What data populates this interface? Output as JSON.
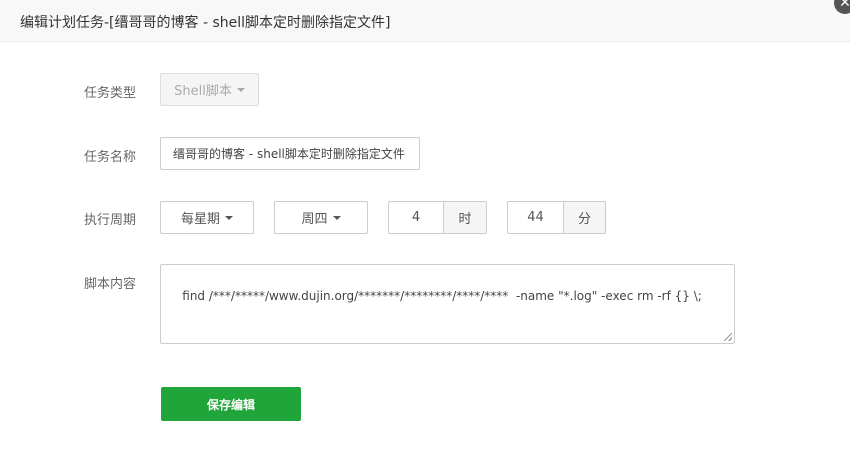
{
  "dialog": {
    "title": "编辑计划任务-[缙哥哥的博客 - shell脚本定时删除指定文件]",
    "close_icon": "close-icon"
  },
  "form": {
    "task_type": {
      "label": "任务类型",
      "value": "Shell脚本",
      "disabled": true
    },
    "task_name": {
      "label": "任务名称",
      "value": "缙哥哥的博客 - shell脚本定时删除指定文件"
    },
    "cycle": {
      "label": "执行周期",
      "period": "每星期",
      "weekday": "周四",
      "hour_value": "4",
      "hour_unit": "时",
      "minute_value": "44",
      "minute_unit": "分"
    },
    "script": {
      "label": "脚本内容",
      "value": "find /***/*****/www.dujin.org/*******/********/****/****  -name \"*.log\" -exec rm -rf {} \\;"
    },
    "save_label": "保存编辑"
  },
  "colors": {
    "primary": "#20a53a",
    "header_bg": "#f8f8f8"
  }
}
